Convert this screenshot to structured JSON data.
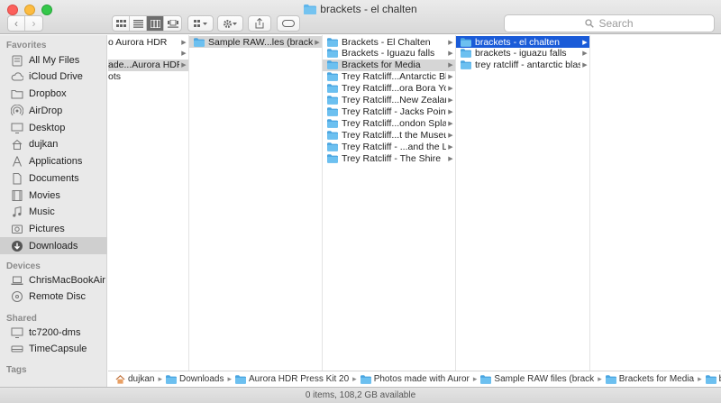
{
  "window": {
    "title": "brackets - el chalten"
  },
  "toolbar": {
    "search_placeholder": "Search",
    "icons": [
      "back-icon",
      "forward-icon",
      "icon-view-icon",
      "list-view-icon",
      "column-view-icon",
      "cover-flow-icon",
      "arrange-icon",
      "action-gear-icon",
      "share-icon",
      "tag-icon"
    ]
  },
  "sidebar": {
    "favorites_header": "Favorites",
    "favorites": [
      {
        "label": "All My Files",
        "icon": "all-files-icon"
      },
      {
        "label": "iCloud Drive",
        "icon": "cloud-icon"
      },
      {
        "label": "Dropbox",
        "icon": "folder-icon"
      },
      {
        "label": "AirDrop",
        "icon": "airdrop-icon"
      },
      {
        "label": "Desktop",
        "icon": "desktop-icon"
      },
      {
        "label": "dujkan",
        "icon": "home-icon"
      },
      {
        "label": "Applications",
        "icon": "applications-icon"
      },
      {
        "label": "Documents",
        "icon": "documents-icon"
      },
      {
        "label": "Movies",
        "icon": "movies-icon"
      },
      {
        "label": "Music",
        "icon": "music-icon"
      },
      {
        "label": "Pictures",
        "icon": "pictures-icon"
      },
      {
        "label": "Downloads",
        "icon": "downloads-icon",
        "selected": true
      }
    ],
    "devices_header": "Devices",
    "devices": [
      {
        "label": "ChrisMacBookAir",
        "icon": "laptop-icon"
      },
      {
        "label": "Remote Disc",
        "icon": "disc-icon"
      }
    ],
    "shared_header": "Shared",
    "shared": [
      {
        "label": "tc7200-dms",
        "icon": "monitor-icon"
      },
      {
        "label": "TimeCapsule",
        "icon": "timecapsule-icon"
      }
    ],
    "tags_header": "Tags"
  },
  "columns": [
    {
      "rows": [
        {
          "label": "o Aurora HDR",
          "arrow": true,
          "state": ""
        },
        {
          "label": "",
          "arrow": true,
          "state": ""
        },
        {
          "label": "ade...Aurora HDR",
          "arrow": true,
          "state": "gray"
        },
        {
          "label": "ots",
          "arrow": false,
          "state": ""
        }
      ]
    },
    {
      "rows": [
        {
          "label": "Sample RAW...les (brackets)",
          "arrow": true,
          "state": "gray",
          "folder": true
        }
      ]
    },
    {
      "rows": [
        {
          "label": "Brackets - El Chalten",
          "arrow": true,
          "state": "",
          "folder": true
        },
        {
          "label": "Brackets - Iguazu falls",
          "arrow": true,
          "state": "",
          "folder": true
        },
        {
          "label": "Brackets for Media",
          "arrow": true,
          "state": "gray",
          "folder": true
        },
        {
          "label": "Trey Ratcliff...Antarctic Blast",
          "arrow": true,
          "state": "",
          "folder": true
        },
        {
          "label": "Trey Ratcliff...ora Bora Yoga",
          "arrow": true,
          "state": "",
          "folder": true
        },
        {
          "label": "Trey Ratcliff...New Zealand",
          "arrow": true,
          "state": "",
          "folder": true
        },
        {
          "label": "Trey Ratcliff - Jacks Point",
          "arrow": true,
          "state": "",
          "folder": true
        },
        {
          "label": "Trey Ratcliff...ondon Splash",
          "arrow": true,
          "state": "",
          "folder": true
        },
        {
          "label": "Trey Ratcliff...t the Museum",
          "arrow": true,
          "state": "",
          "folder": true
        },
        {
          "label": "Trey Ratcliff - ...and the Lake",
          "arrow": true,
          "state": "",
          "folder": true
        },
        {
          "label": "Trey Ratcliff - The Shire",
          "arrow": true,
          "state": "",
          "folder": true
        }
      ]
    },
    {
      "rows": [
        {
          "label": "brackets - el chalten",
          "arrow": true,
          "state": "blue",
          "folder": true
        },
        {
          "label": "brackets - iguazu falls",
          "arrow": true,
          "state": "",
          "folder": true
        },
        {
          "label": "trey ratcliff - antarctic blast",
          "arrow": true,
          "state": "",
          "folder": true
        }
      ]
    }
  ],
  "pathbar": [
    {
      "label": "dujkan",
      "icon": "home-icon"
    },
    {
      "label": "Downloads",
      "icon": "folder-icon"
    },
    {
      "label": "Aurora HDR Press Kit 20",
      "icon": "folder-icon"
    },
    {
      "label": "Photos made with Auror",
      "icon": "folder-icon"
    },
    {
      "label": "Sample RAW files (brack",
      "icon": "folder-icon"
    },
    {
      "label": "Brackets for Media",
      "icon": "folder-icon"
    },
    {
      "label": "brackets - el chalten",
      "icon": "folder-icon"
    }
  ],
  "status": "0 items, 108,2 GB available",
  "colors": {
    "selection_blue": "#1a5bd8",
    "folder_blue": "#5fb6ec"
  }
}
